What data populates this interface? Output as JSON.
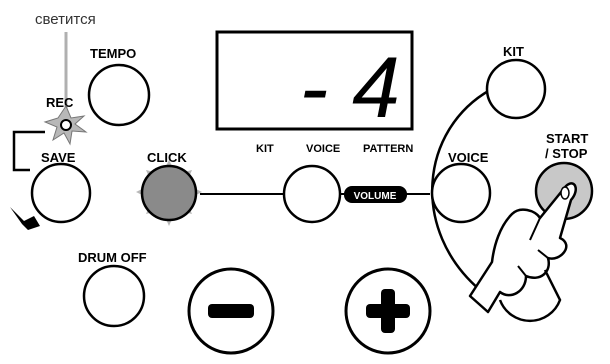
{
  "annotation": {
    "text": "светится"
  },
  "display": {
    "value": "- 4"
  },
  "display_labels": {
    "kit": "KIT",
    "voice": "VOICE",
    "pattern": "PATTERN"
  },
  "buttons": {
    "tempo": "TEMPO",
    "rec": "REC",
    "save": "SAVE",
    "click": "CLICK",
    "drum_off": "DRUM OFF",
    "kit": "KIT",
    "voice": "VOICE",
    "start_stop_line1": "START",
    "start_stop_line2": "/ STOP",
    "volume": "VOLUME"
  },
  "colors": {
    "ink": "#000000",
    "lit_indicator": "#8a8a8a",
    "lit_glow": "#b8b8b8",
    "pressed_button": "#c8c8c8",
    "annotation_line": "#b0b0b0"
  }
}
